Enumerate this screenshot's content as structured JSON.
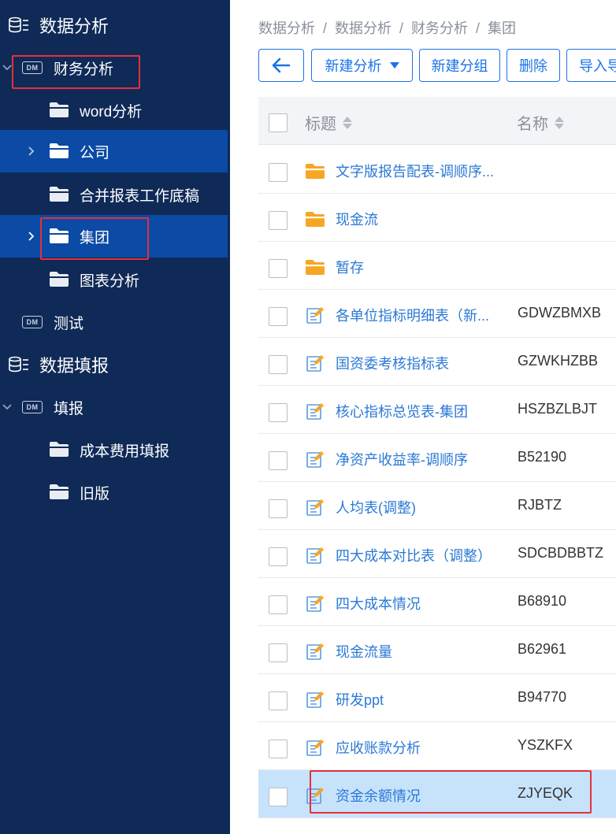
{
  "sidebar": {
    "groups": [
      {
        "label": "数据分析"
      },
      {
        "label": "数据填报"
      }
    ],
    "items": [
      {
        "label": "财务分析",
        "icon": "dm-icon"
      },
      {
        "label": "word分析",
        "icon": "folder-icon"
      },
      {
        "label": "公司",
        "icon": "folder-icon"
      },
      {
        "label": "合并报表工作底稿",
        "icon": "folder-icon"
      },
      {
        "label": "集团",
        "icon": "folder-icon"
      },
      {
        "label": "图表分析",
        "icon": "folder-icon"
      },
      {
        "label": "测试",
        "icon": "dm-icon"
      },
      {
        "label": "填报",
        "icon": "dm-icon"
      },
      {
        "label": "成本费用填报",
        "icon": "folder-icon"
      },
      {
        "label": "旧版",
        "icon": "folder-icon"
      }
    ],
    "dm_badge": "DM"
  },
  "breadcrumb": [
    "数据分析",
    "数据分析",
    "财务分析",
    "集团"
  ],
  "breadcrumb_sep": "/",
  "toolbar": {
    "new_analysis": "新建分析",
    "new_group": "新建分组",
    "delete": "删除",
    "import": "导入导出"
  },
  "table": {
    "columns": [
      "标题",
      "名称"
    ],
    "rows": [
      {
        "type": "folder",
        "title": "文字版报告配表-调顺序...",
        "code": ""
      },
      {
        "type": "folder",
        "title": "现金流",
        "code": ""
      },
      {
        "type": "folder",
        "title": "暂存",
        "code": ""
      },
      {
        "type": "report",
        "title": "各单位指标明细表（新...",
        "code": "GDWZBMXB"
      },
      {
        "type": "report",
        "title": "国资委考核指标表",
        "code": "GZWKHZBB"
      },
      {
        "type": "report",
        "title": "核心指标总览表-集团",
        "code": "HSZBZLBJT"
      },
      {
        "type": "report",
        "title": "净资产收益率-调顺序",
        "code": "B52190"
      },
      {
        "type": "report",
        "title": "人均表(调整)",
        "code": "RJBTZ"
      },
      {
        "type": "report",
        "title": "四大成本对比表（调整）",
        "code": "SDCBDBBTZ"
      },
      {
        "type": "report",
        "title": "四大成本情况",
        "code": "B68910"
      },
      {
        "type": "report",
        "title": "现金流量",
        "code": "B62961"
      },
      {
        "type": "report",
        "title": "研发ppt",
        "code": "B94770"
      },
      {
        "type": "report",
        "title": "应收账款分析",
        "code": "YSZKFX"
      },
      {
        "type": "report",
        "title": "资金余额情况",
        "code": "ZJYEQK"
      }
    ]
  },
  "colors": {
    "sidebar_bg": "#0f2a57",
    "sidebar_selected": "#0b4aa5",
    "accent": "#1a73e8",
    "folder": "#f5a623",
    "highlight_box": "#e5303a",
    "row_selected": "#c7e3fb"
  }
}
